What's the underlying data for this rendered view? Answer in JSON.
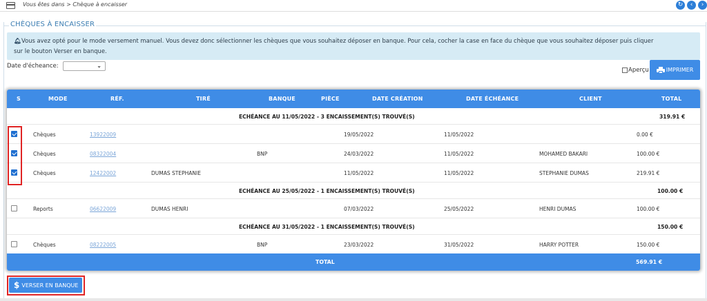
{
  "breadcrumb": {
    "text": "Vous êtes dans > Chèque à encaisser"
  },
  "panel": {
    "title": "CHÈQUES À ENCAISSER"
  },
  "info": {
    "line1": "Vous avez opté pour le mode versement manuel. Vous devez donc sélectionner les chèques que vous souhaitez déposer en banque. Pour cela, cocher la case en face du chèque que vous souhaitez déposer puis cliquer",
    "line2": "sur le bouton Verser en banque."
  },
  "filter": {
    "label": "Date d'écheance:",
    "value": ""
  },
  "apercu": {
    "label": "Aperçu",
    "checked": false
  },
  "print_button": {
    "label": "IMPRIMER"
  },
  "table": {
    "headers": {
      "s": "S",
      "mode": "MODE",
      "ref": "RÉF.",
      "tire": "TIRÉ",
      "banque": "BANQUE",
      "piece": "PIÈCE",
      "date_creation": "DATE CRÉATION",
      "date_echeance": "DATE ÉCHÉANCE",
      "client": "CLIENT",
      "total": "TOTAL"
    },
    "groups": [
      {
        "title": "ECHÉANCE AU 11/05/2022 - 3 ENCAISSEMENT(S) TROUVÉ(S)",
        "total": "319.91 €",
        "rows": [
          {
            "checked": true,
            "mode": "Chèques",
            "ref": "13922009",
            "tire": "",
            "banque": "",
            "piece": "",
            "date_creation": "19/05/2022",
            "date_echeance": "11/05/2022",
            "client": "",
            "total": "0.00 €"
          },
          {
            "checked": true,
            "mode": "Chèques",
            "ref": "08322004",
            "tire": "",
            "banque": "BNP",
            "piece": "",
            "date_creation": "24/03/2022",
            "date_echeance": "11/05/2022",
            "client": "MOHAMED BAKARI",
            "total": "100.00 €"
          },
          {
            "checked": true,
            "mode": "Chèques",
            "ref": "12422002",
            "tire": "DUMAS STEPHANIE",
            "banque": "",
            "piece": "",
            "date_creation": "11/05/2022",
            "date_echeance": "11/05/2022",
            "client": "STEPHANIE DUMAS",
            "total": "219.91 €"
          }
        ]
      },
      {
        "title": "ECHÉANCE AU 25/05/2022 - 1 ENCAISSEMENT(S) TROUVÉ(S)",
        "total": "100.00 €",
        "rows": [
          {
            "checked": false,
            "mode": "Reports",
            "ref": "06622009",
            "tire": "DUMAS HENRI",
            "banque": "",
            "piece": "",
            "date_creation": "07/03/2022",
            "date_echeance": "25/05/2022",
            "client": "HENRI DUMAS",
            "total": "100.00 €"
          }
        ]
      },
      {
        "title": "ECHÉANCE AU 31/05/2022 - 1 ENCAISSEMENT(S) TROUVÉ(S)",
        "total": "150.00 €",
        "rows": [
          {
            "checked": false,
            "mode": "Chèques",
            "ref": "08222005",
            "tire": "",
            "banque": "BNP",
            "piece": "",
            "date_creation": "23/03/2022",
            "date_echeance": "31/05/2022",
            "client": "HARRY POTTER",
            "total": "150.00 €"
          }
        ]
      }
    ],
    "footer": {
      "label": "TOTAL",
      "total": "569.91 €"
    }
  },
  "verser_button": {
    "label": "VERSER EN BANQUE"
  },
  "colors": {
    "accent": "#3f8ce6",
    "info_bg": "#d6ebf5",
    "highlight": "#e02424",
    "link": "#7aa5d8"
  }
}
